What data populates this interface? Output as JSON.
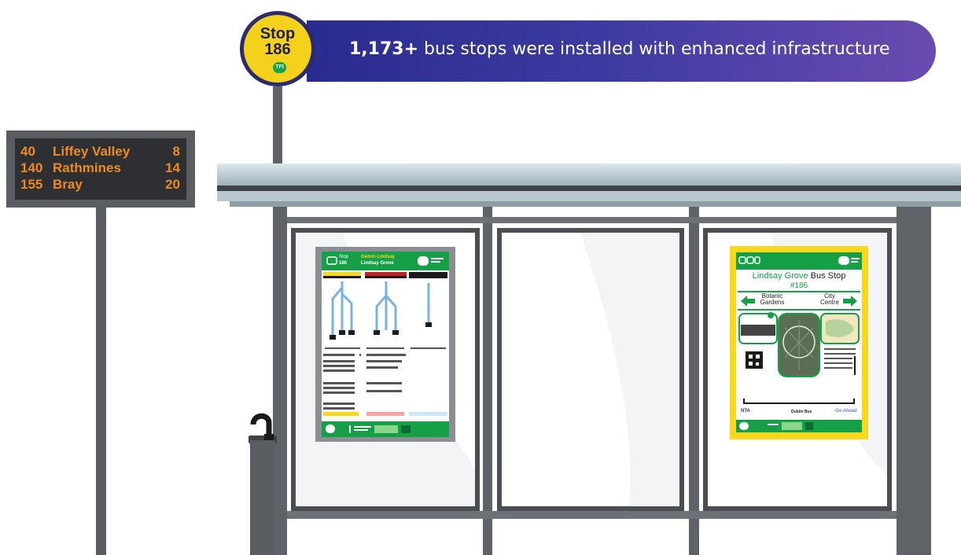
{
  "stop_sign": {
    "word": "Stop",
    "number": "186",
    "brand": "TFI"
  },
  "banner": {
    "highlight": "1,173+",
    "text": " bus stops were installed with enhanced infrastructure"
  },
  "rtpi": {
    "rows": [
      {
        "route": "40",
        "destination": "Liffey Valley",
        "minutes": "8"
      },
      {
        "route": "140",
        "destination": "Rathmines",
        "minutes": "14"
      },
      {
        "route": "155",
        "destination": "Bray",
        "minutes": "20"
      }
    ]
  },
  "poster_left": {
    "stop_label": "Stop",
    "stop_number": "186",
    "stop_name_1": "Gemin Lindsay",
    "stop_name_2": "Lindsay Grove"
  },
  "poster_right": {
    "title_green": "Lindsay Grove",
    "title_dark": "Bus Stop",
    "number": "#186",
    "left_dir_1": "Botanic",
    "left_dir_2": "Gardens",
    "right_dir_1": "City",
    "right_dir_2": "Centre",
    "logo_nta": "NTA",
    "logo_dublin_bus": "Dublin Bus",
    "logo_go_ahead": "Go-Ahead"
  },
  "colors": {
    "tfi_green": "#15a047",
    "stop_yellow": "#f4d11a",
    "rtpi_amber": "#ef8a1d",
    "banner_start": "#2a2b8f",
    "banner_end": "#6a4bb0"
  }
}
